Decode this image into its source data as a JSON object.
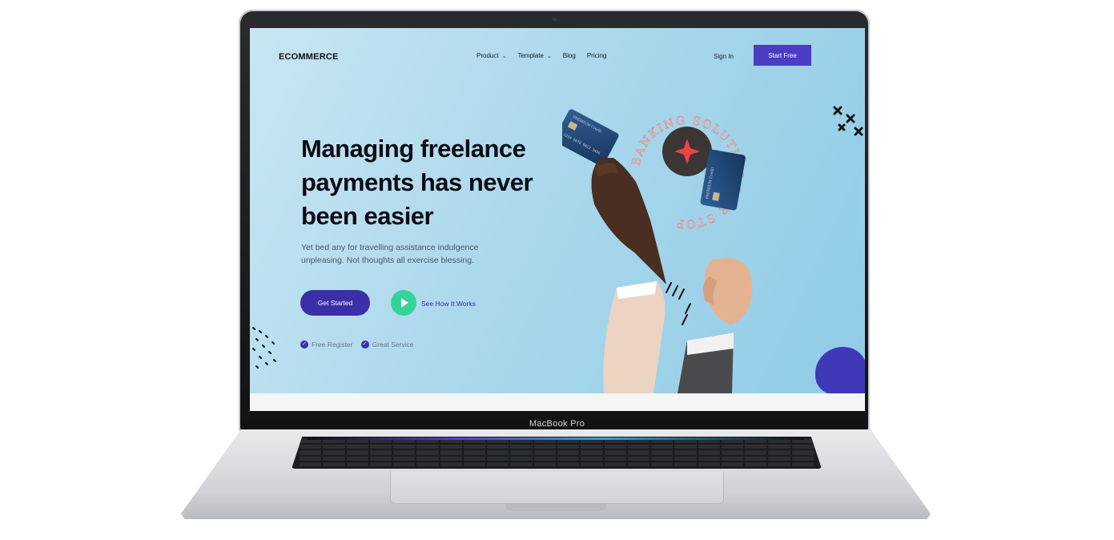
{
  "device": {
    "bezel_label": "MacBook Pro"
  },
  "nav": {
    "logo": "ECOMMERCE",
    "links": [
      {
        "label": "Product",
        "has_dropdown": true
      },
      {
        "label": "Template",
        "has_dropdown": true
      },
      {
        "label": "Blog",
        "has_dropdown": false
      },
      {
        "label": "Pricing",
        "has_dropdown": false
      }
    ],
    "sign_in": "Sign In",
    "cta": "Start Free"
  },
  "hero": {
    "title": "Managing freelance payments has never been easier",
    "subtitle": "Yet bed any for travelling assistance indulgence unpleasing. Not thoughts all exercise blessing.",
    "primary_button": "Get Started",
    "secondary_link": "See How It Works",
    "features": [
      "Free Register",
      "Great Service"
    ]
  },
  "illustration": {
    "badge_text": "BANKING SOLUTION ONE STOP",
    "card_brand": "PREMIUM Credit",
    "card_number": "1234 5678 9012 3456"
  },
  "colors": {
    "primary": "#4a3cc5",
    "primary_dark": "#3a2fa8",
    "accent_green": "#34d399",
    "hero_bg": "#abd8ec"
  }
}
